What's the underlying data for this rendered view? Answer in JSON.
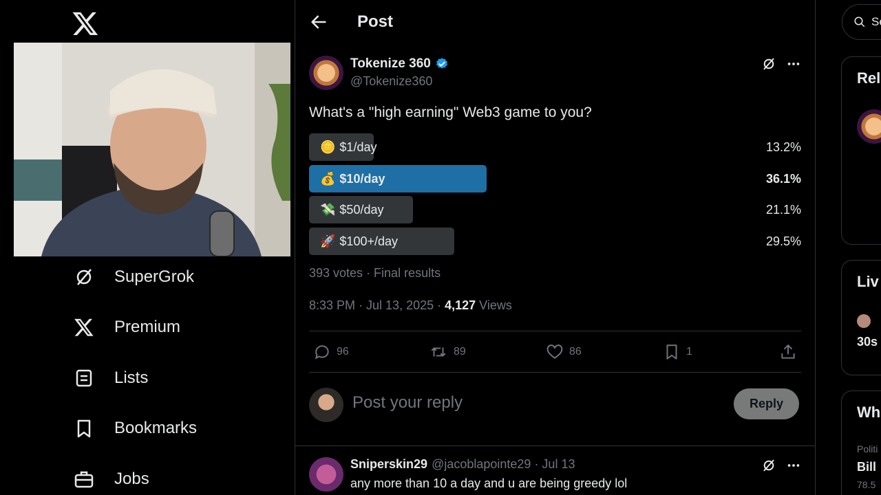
{
  "left_nav": {
    "items": [
      {
        "label": "SuperGrok",
        "icon": "supergrok-icon"
      },
      {
        "label": "Premium",
        "icon": "x-logo-icon"
      },
      {
        "label": "Lists",
        "icon": "lists-icon"
      },
      {
        "label": "Bookmarks",
        "icon": "bookmark-icon"
      },
      {
        "label": "Jobs",
        "icon": "briefcase-icon"
      }
    ]
  },
  "header": {
    "title": "Post"
  },
  "post": {
    "author_name": "Tokenize 360",
    "handle": "@Tokenize360",
    "question": "What's a \"high earning\" Web3 game to you?",
    "poll": [
      {
        "emoji": "🪙",
        "label": "$1/day",
        "pct_text": "13.2%",
        "pct": 13.2,
        "winner": false
      },
      {
        "emoji": "💰",
        "label": "$10/day",
        "pct_text": "36.1%",
        "pct": 36.1,
        "winner": true
      },
      {
        "emoji": "💸",
        "label": "$50/day",
        "pct_text": "21.1%",
        "pct": 21.1,
        "winner": false
      },
      {
        "emoji": "🚀",
        "label": "$100+/day",
        "pct_text": "29.5%",
        "pct": 29.5,
        "winner": false
      }
    ],
    "votes_text": "393 votes · Final results",
    "time_text": "8:33 PM · Jul 13, 2025 · ",
    "views_count": "4,127",
    "views_label": " Views",
    "stats": {
      "replies": "96",
      "reposts": "89",
      "likes": "86",
      "bookmarks": "1"
    }
  },
  "reply_box": {
    "placeholder": "Post your reply",
    "button": "Reply"
  },
  "comment": {
    "name": "Sniperskin29",
    "handle_time": "@jacoblapointe29 · Jul 13",
    "text": "any more than 10 a day and u are being greedy lol"
  },
  "right": {
    "search_text": "Se",
    "cards": [
      "Rel",
      "Liv",
      "Wh"
    ],
    "live_text": "30s",
    "trend_category": "Politi",
    "trend_title": "Bill",
    "trend_count": "78.5"
  },
  "colors": {
    "accent": "#1d9bf0",
    "winner_bar": "#1d6fa5",
    "bar": "#333639",
    "muted": "#71767b"
  }
}
